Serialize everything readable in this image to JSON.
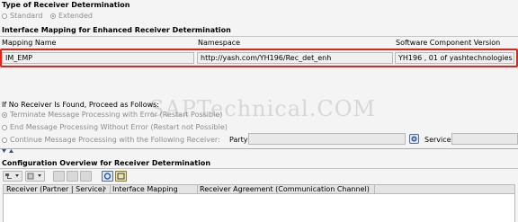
{
  "receiver_determination": {
    "title": "Type of Receiver Determination",
    "options": [
      "Standard",
      "Extended"
    ],
    "selected": "Extended"
  },
  "interface_mapping": {
    "title": "Interface Mapping for Enhanced Receiver Determination",
    "columns": [
      "Mapping Name",
      "Namespace",
      "Software Component Version"
    ],
    "mapping_name": "IM_EMP",
    "namespace": "http://yash.com/YH196/Rec_det_enh",
    "software_component_version": "YH196 , 01 of yashtechnologies"
  },
  "no_receiver": {
    "title": "If No Receiver Is Found, Proceed as Follows:",
    "options": [
      "Terminate Message Processing with Error (Restart Possible)",
      "End Message Processing Without Error (Restart not Possible)",
      "Continue Message Processing with the Following Receiver:"
    ],
    "selected_index": 0,
    "party_label": "Party",
    "service_label": "Service"
  },
  "watermark": "SAPTechnical.COM",
  "configuration_overview": {
    "title": "Configuration Overview for Receiver Determination",
    "columns": [
      "Receiver (Partner | Service)",
      "Interface Mapping",
      "Receiver Agreement (Communication Channel)"
    ]
  },
  "icons": {
    "value_help": "value-help-icon",
    "toolbar": [
      "expand-tree-icon",
      "collapse-tree-icon",
      "toolbar-icon-1",
      "toolbar-icon-2",
      "toolbar-icon-3",
      "refresh-icon",
      "layout-icon"
    ]
  },
  "colors": {
    "highlight_border": "#e2231a",
    "background": "#f4f4f4"
  }
}
